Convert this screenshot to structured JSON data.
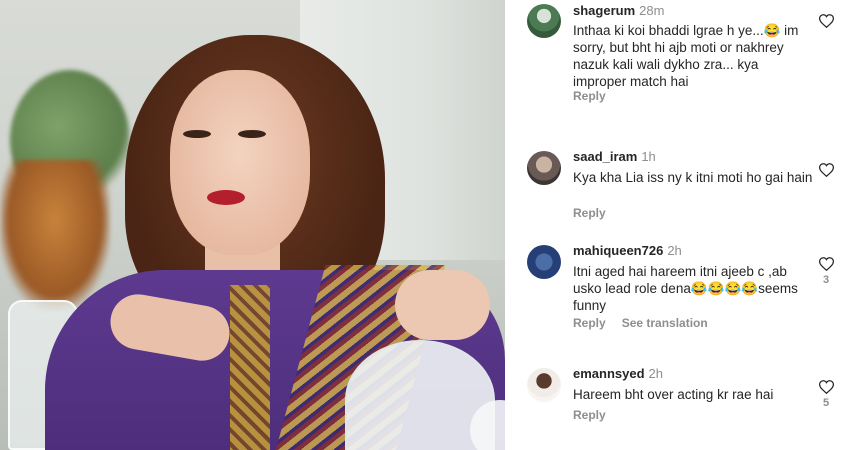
{
  "comments": [
    {
      "username": "shagerum",
      "time": "28m",
      "text": "Inthaa ki koi bhaddi lgrae h ye...😂 im sorry, but bht hi ajb moti  or nakhrey nazuk kali wali dykho zra... kya improper match hai",
      "reply_label": "Reply",
      "likes": ""
    },
    {
      "username": "saad_iram",
      "time": "1h",
      "text": "Kya kha Lia iss ny k itni moti ho gai hain",
      "reply_label": "Reply",
      "likes": ""
    },
    {
      "username": "mahiqueen726",
      "time": "2h",
      "text": "Itni aged hai hareem itni ajeeb c ,ab usko lead role dena😂😂😂😂seems funny",
      "reply_label": "Reply",
      "see_translation_label": "See translation",
      "likes": "3"
    },
    {
      "username": "emannsyed",
      "time": "2h",
      "text": "Hareem bht over acting kr rae hai",
      "reply_label": "Reply",
      "likes": "5"
    }
  ],
  "icons": {
    "like": "heart-outline-icon"
  },
  "colors": {
    "text_primary": "#262626",
    "text_secondary": "#8e8e8e"
  }
}
